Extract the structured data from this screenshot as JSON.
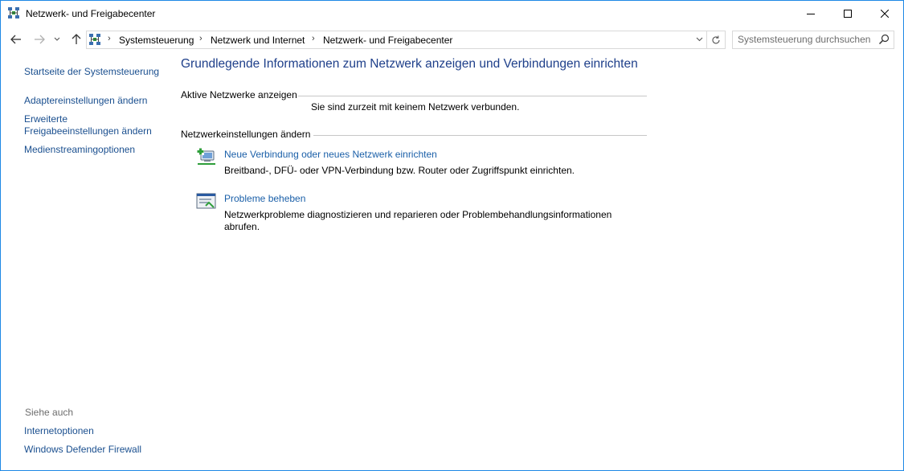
{
  "window": {
    "title": "Netzwerk- und Freigabecenter"
  },
  "breadcrumb": {
    "items": [
      "Systemsteuerung",
      "Netzwerk und Internet",
      "Netzwerk- und Freigabecenter"
    ]
  },
  "search": {
    "placeholder": "Systemsteuerung durchsuchen"
  },
  "sidebar": {
    "home_link": "Startseite der Systemsteuerung",
    "items": [
      "Adaptereinstellungen ändern",
      "Erweiterte",
      "Freigabeeinstellungen ändern",
      "Medienstreamingoptionen"
    ],
    "see_also_label": "Siehe auch",
    "see_also_items": [
      "Internetoptionen",
      "Windows Defender Firewall"
    ]
  },
  "main": {
    "heading": "Grundlegende Informationen zum Netzwerk anzeigen und Verbindungen einrichten",
    "active_networks_label": "Aktive Netzwerke anzeigen",
    "no_network_text": "Sie sind zurzeit mit keinem Netzwerk verbunden.",
    "change_settings_label": "Netzwerkeinstellungen ändern",
    "tasks": [
      {
        "link": "Neue Verbindung oder neues Netzwerk einrichten",
        "desc": "Breitband-, DFÜ- oder VPN-Verbindung bzw. Router oder Zugriffspunkt einrichten."
      },
      {
        "link": "Probleme beheben",
        "desc_line1": "Netzwerkprobleme diagnostizieren und reparieren oder Problembehandlungsinformationen",
        "desc_line2": "abrufen."
      }
    ]
  },
  "icons": {
    "window": "network-sharing-icon",
    "back": "back-arrow-icon",
    "forward": "forward-arrow-icon",
    "recent": "chevron-down-icon",
    "up": "up-arrow-icon",
    "refresh": "refresh-icon",
    "search": "search-icon",
    "new_connection": "new-connection-icon",
    "troubleshoot": "troubleshoot-icon"
  },
  "colors": {
    "window_border": "#1e88e5",
    "link": "#1a4f8f",
    "heading": "#1e3f8a",
    "muted": "#6d6d6d"
  }
}
